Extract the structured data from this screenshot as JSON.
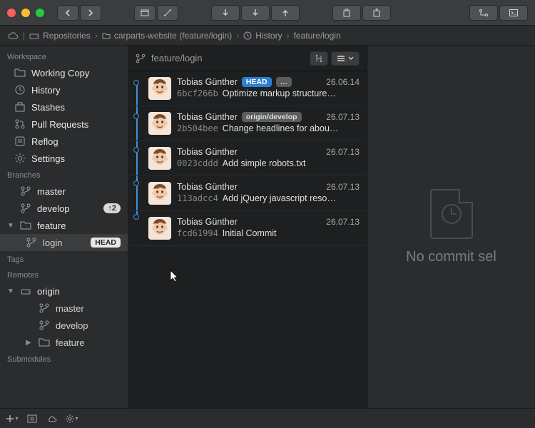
{
  "breadcrumb": {
    "root": "Repositories",
    "repo": "carparts-website (feature/login)",
    "view": "History",
    "ref": "feature/login"
  },
  "sidebar": {
    "workspace_header": "Workspace",
    "workspace": [
      {
        "icon": "folder",
        "label": "Working Copy"
      },
      {
        "icon": "clock",
        "label": "History"
      },
      {
        "icon": "stash",
        "label": "Stashes"
      },
      {
        "icon": "pr",
        "label": "Pull Requests"
      },
      {
        "icon": "reflog",
        "label": "Reflog"
      },
      {
        "icon": "gear",
        "label": "Settings"
      }
    ],
    "branches_header": "Branches",
    "branches": [
      {
        "label": "master",
        "badge": null,
        "head": false,
        "expandable": false
      },
      {
        "label": "develop",
        "badge": "↑2",
        "head": false,
        "expandable": false
      },
      {
        "label": "feature",
        "badge": null,
        "head": false,
        "expandable": true,
        "expanded": true,
        "children": [
          {
            "label": "login",
            "head": true
          }
        ]
      }
    ],
    "tags_header": "Tags",
    "remotes_header": "Remotes",
    "remotes": [
      {
        "label": "origin",
        "expanded": true,
        "children": [
          {
            "label": "master"
          },
          {
            "label": "develop"
          },
          {
            "label": "feature",
            "expandable": true
          }
        ]
      }
    ],
    "submodules_header": "Submodules"
  },
  "center": {
    "branch_label": "feature/login"
  },
  "commits": [
    {
      "author": "Tobias Günther",
      "date": "26.06.14",
      "hash": "6bcf266b",
      "message": "Optimize markup structure…",
      "head": "HEAD",
      "extra": "…"
    },
    {
      "author": "Tobias Günther",
      "date": "26.07.13",
      "hash": "2b504bee",
      "message": "Change headlines for abou…",
      "ref": "origin/develop"
    },
    {
      "author": "Tobias Günther",
      "date": "26.07.13",
      "hash": "0023cddd",
      "message": "Add simple robots.txt"
    },
    {
      "author": "Tobias Günther",
      "date": "26.07.13",
      "hash": "113adcc4",
      "message": "Add jQuery javascript reso…"
    },
    {
      "author": "Tobias Günther",
      "date": "26.07.13",
      "hash": "fcd61994",
      "message": "Initial Commit"
    }
  ],
  "right": {
    "empty_text": "No commit sel"
  },
  "badges": {
    "head_label": "HEAD"
  }
}
